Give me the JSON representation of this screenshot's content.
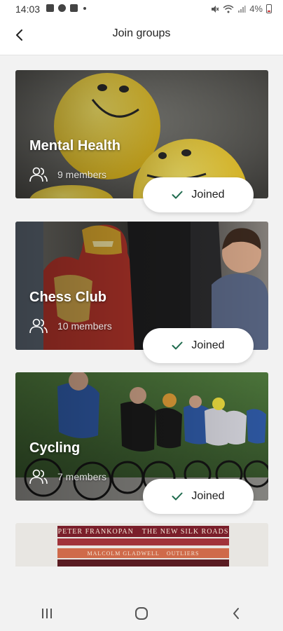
{
  "status_bar": {
    "time": "14:03",
    "battery": "4%"
  },
  "header": {
    "title": "Join groups",
    "back_icon": "back-arrow-icon"
  },
  "groups": [
    {
      "name": "Mental Health",
      "members": "9 members",
      "status": "Joined",
      "image": "yellow smiley balloons"
    },
    {
      "name": "Chess Club",
      "members": "10 members",
      "status": "Joined",
      "image": "iron man costume crowd"
    },
    {
      "name": "Cycling",
      "members": "7 members",
      "status": "Joined",
      "image": "cyclists racing"
    }
  ],
  "partial_card": {
    "book1_author": "PETER FRANKOPAN",
    "book1_title": "THE NEW SILK ROADS",
    "book2_author": "MALCOLM GLADWELL",
    "book2_title": "OUTLIERS"
  },
  "colors": {
    "accent": "#1f6b4e",
    "background": "#f2f2f2",
    "button_bg": "#ffffff"
  },
  "nav": {
    "recent_icon": "recent-apps-icon",
    "home_icon": "home-icon",
    "back_icon": "back-icon"
  }
}
